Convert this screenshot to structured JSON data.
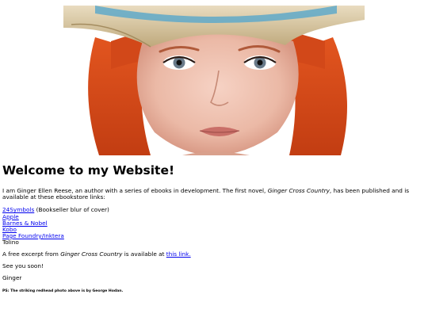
{
  "hero": {
    "image_subject": "redhead-woman-in-straw-hat-photo"
  },
  "main": {
    "heading": "Welcome to my Website!",
    "intro": {
      "part1": "I am Ginger Ellen Reese, an author with a series of ebooks in development. The first novel, ",
      "title": "Ginger Cross Country",
      "part2": ", has been published and is available at these ebookstore links:"
    },
    "stores": [
      {
        "label": "24Symbols",
        "note": " (Bookseller blur of cover)",
        "link": true
      },
      {
        "label": "Apple",
        "note": "",
        "link": true
      },
      {
        "label": "Barnes & Nobel",
        "note": "",
        "link": true
      },
      {
        "label": "Kobo",
        "note": "",
        "link": true
      },
      {
        "label": "Page Foundry/Inktera",
        "note": "",
        "link": true
      },
      {
        "label": "Tolino",
        "note": "",
        "link": false
      }
    ],
    "excerpt": {
      "part1": "A free excerpt from ",
      "title": "Ginger Cross Country",
      "part2": " is available at ",
      "link": "this link."
    },
    "see_you": "See you soon!",
    "signature": "Ginger",
    "ps": "PS: The striking redhead photo above is by George Hodan."
  },
  "colors": {
    "link": "#0000ee",
    "hair": "#d94a1c",
    "hat": "#cdb98f",
    "hat_band": "#5fa9c9"
  }
}
